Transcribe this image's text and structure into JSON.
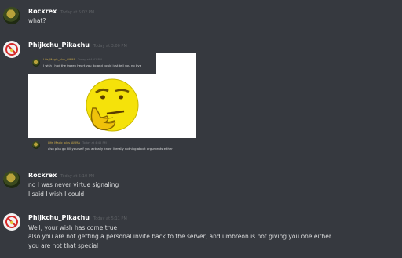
{
  "messages": [
    {
      "author": "Rockrex",
      "timestamp": "Today at 5:02 PM",
      "lines": [
        "what?"
      ]
    },
    {
      "author": "Phijkchu_Pikachu",
      "timestamp": "Today at 3:00 PM",
      "attachment": {
        "top_message": {
          "author": "Life_Magic_plus_AMMA",
          "timestamp": "Today at 4:41 PM",
          "text": "I wish I had the frozen heart you do and could just tell you no bye"
        },
        "bottom_message": {
          "author": "Life_Magic_plus_AMMA",
          "timestamp": "Today at 4:45 PM",
          "text": "also pika go kill yourself you actually know literally nothing about arguments either"
        }
      }
    },
    {
      "author": "Rockrex",
      "timestamp": "Today at 5:10 PM",
      "lines": [
        "no I was never virtue signaling",
        "I said I wish I could"
      ]
    },
    {
      "author": "Phijkchu_Pikachu",
      "timestamp": "Today at 5:11 PM",
      "lines": [
        "Well, your wish has come true",
        "also you are not getting a personal invite back to the server, and umbreon is not giving you one either",
        "you are not that special"
      ]
    }
  ],
  "icons": {
    "rockrex_avatar": "dinosaur-avatar-icon",
    "pikachu_avatar": "no-symbol-avatar-icon",
    "thinking_emoji": "thinking-face-icon"
  },
  "colors": {
    "background": "#36393f",
    "text": "#dcddde",
    "username": "#ffffff",
    "timestamp": "#5f6266",
    "no_symbol": "#d52a2a",
    "emoji_yellow": "#f5e20a"
  }
}
